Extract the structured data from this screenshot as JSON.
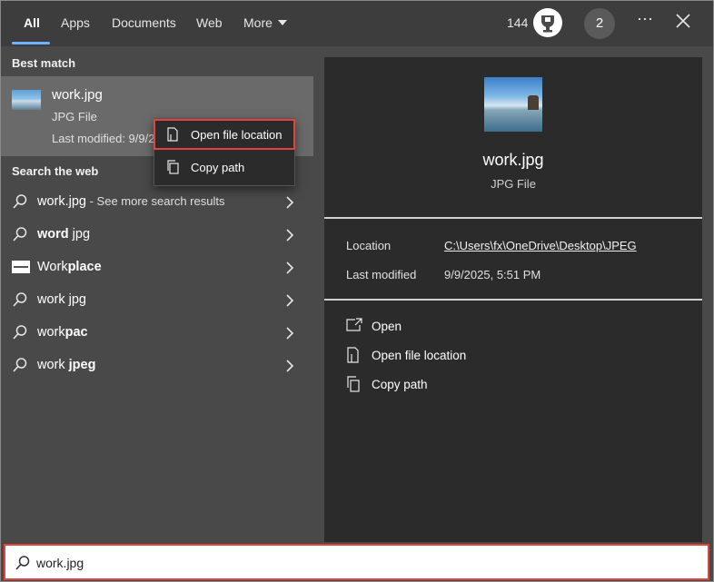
{
  "tabs": [
    {
      "label": "All"
    },
    {
      "label": "Apps"
    },
    {
      "label": "Documents"
    },
    {
      "label": "Web"
    },
    {
      "label": "More"
    }
  ],
  "header": {
    "points": "144",
    "avatar_initial": "2",
    "more_options": "⋯"
  },
  "left": {
    "best_match_title": "Best match",
    "best_match": {
      "name": "work.jpg",
      "type": "JPG File",
      "modified": "Last modified: 9/9/2"
    },
    "web_title": "Search the web",
    "web_results": [
      {
        "text": "work.jpg",
        "suffix": " - See more search results"
      },
      {
        "normal": "",
        "bold": "word",
        "tail": " jpg"
      },
      {
        "normal": "Work",
        "bold": "place",
        "tail": ""
      },
      {
        "normal": "work jpg",
        "bold": "",
        "tail": ""
      },
      {
        "normal": "work",
        "bold": "pac",
        "tail": ""
      },
      {
        "normal": "work ",
        "bold": "jpeg",
        "tail": ""
      }
    ]
  },
  "context_menu": {
    "items": [
      {
        "label": "Open file location",
        "icon": "folder-location-icon"
      },
      {
        "label": "Copy path",
        "icon": "copy-icon"
      }
    ]
  },
  "preview": {
    "name": "work.jpg",
    "type": "JPG File",
    "location_label": "Location",
    "location_value": "C:\\Users\\fx\\OneDrive\\Desktop\\JPEG",
    "modified_label": "Last modified",
    "modified_value": "9/9/2025, 5:51 PM",
    "actions": [
      {
        "label": "Open",
        "icon": "open-icon"
      },
      {
        "label": "Open file location",
        "icon": "folder-location-icon"
      },
      {
        "label": "Copy path",
        "icon": "copy-icon"
      }
    ]
  },
  "search": {
    "value": "work.jpg"
  },
  "colors": {
    "accent": "#6fb2ff",
    "highlight_outline": "#e0443a"
  }
}
